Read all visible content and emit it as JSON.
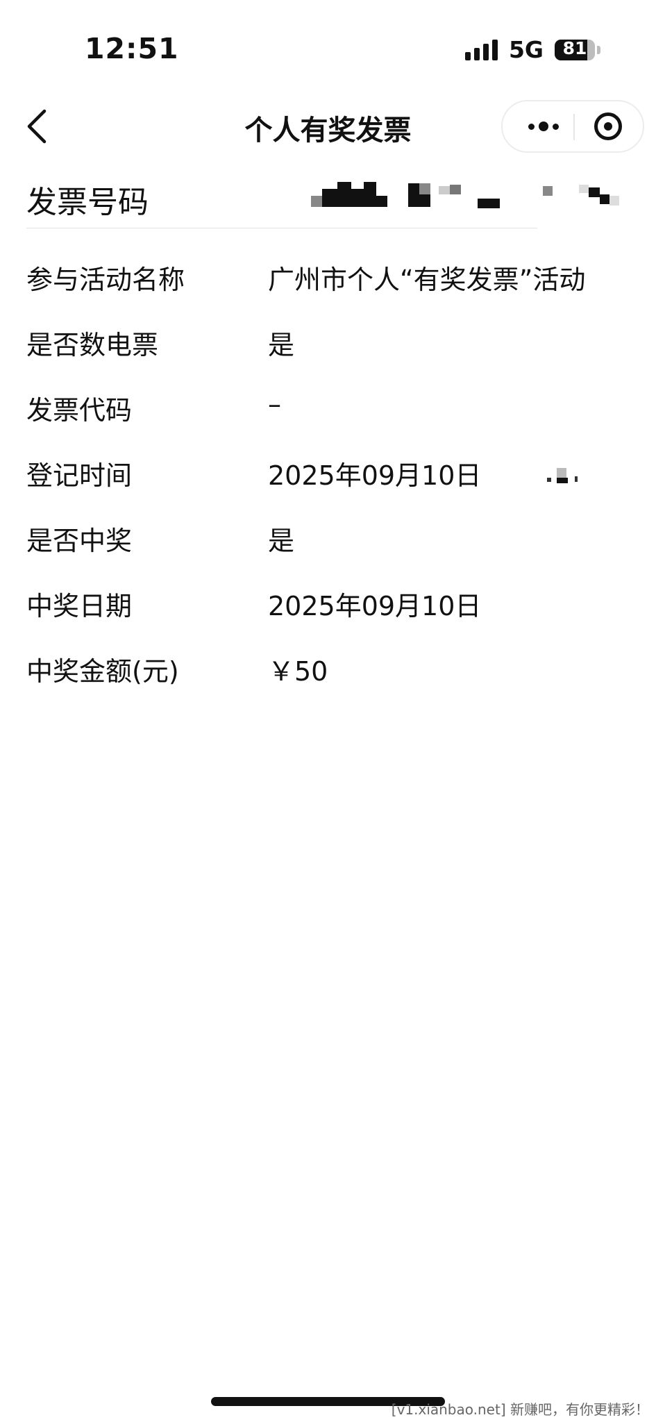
{
  "status_bar": {
    "time": "12:51",
    "network": "5G",
    "battery": "81",
    "battery_level": 0.81
  },
  "nav": {
    "title": "个人有奖发票"
  },
  "invoice_number": {
    "label": "发票号码"
  },
  "details": [
    {
      "label": "参与活动名称",
      "value": "广州市个人“有奖发票”活动"
    },
    {
      "label": "是否数电票",
      "value": "是"
    },
    {
      "label": "发票代码",
      "value": "–"
    },
    {
      "label": "登记时间",
      "value": "2025年09月10日"
    },
    {
      "label": "是否中奖",
      "value": "是"
    },
    {
      "label": "中奖日期",
      "value": "2025年09月10日"
    },
    {
      "label": "中奖金额(元)",
      "value": "￥50"
    }
  ],
  "watermark": "[v1.xianbao.net] 新赚吧，有你更精彩！",
  "colors": {
    "text": "#111111",
    "background": "#ffffff",
    "divider": "#e2e2e2"
  }
}
